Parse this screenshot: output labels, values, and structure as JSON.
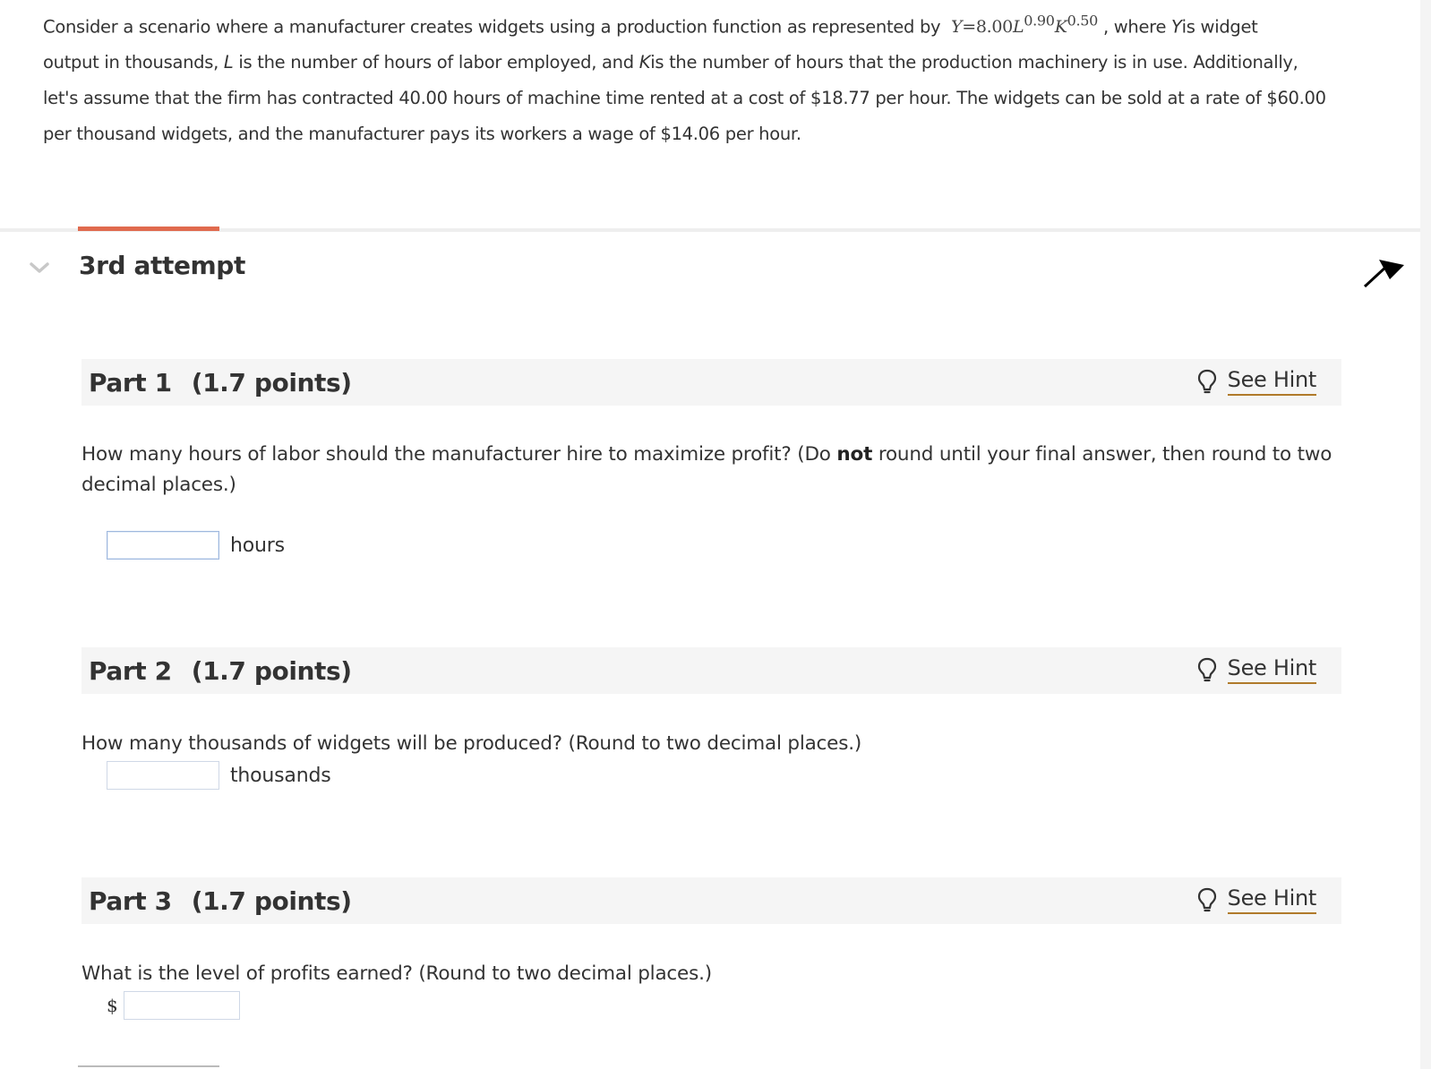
{
  "problem": {
    "line1_a": "Consider a scenario where a manufacturer creates widgets using a production function as represented by",
    "formula": {
      "lhs": "Y",
      "eq": "=8.00",
      "L": "L",
      "L_exp": "0.90",
      "K": "K",
      "K_exp": "0.50"
    },
    "line1_b": ", where",
    "line1_var": "Y",
    "line1_c": "is widget",
    "line2_a": "output in thousands,",
    "line2_var1": "L",
    "line2_b": "is the number of hours of labor employed, and",
    "line2_var2": "K",
    "line2_c": "is the number of hours that the production machinery is in use. Additionally,",
    "line3": "let's assume that the firm has contracted 40.00  hours of machine time rented at a cost of $18.77  per hour. The widgets can be sold at a rate of $60.00",
    "line4": "per thousand widgets, and the manufacturer pays its workers a wage of $14.06  per hour."
  },
  "attempt": {
    "title": "3rd attempt",
    "progress_fraction": 0.1
  },
  "parts": [
    {
      "label": "Part 1",
      "points": "(1.7 points)",
      "hint": "See Hint",
      "question_a": "How many hours of labor should the manufacturer hire to maximize profit? (Do",
      "question_bold": "not",
      "question_b": "round until your final answer, then round to two",
      "question_c": "decimal places.)",
      "unit": "hours",
      "value": ""
    },
    {
      "label": "Part 2",
      "points": "(1.7 points)",
      "hint": "See Hint",
      "question": "How many thousands of widgets will be produced? (Round to two decimal places.)",
      "unit": "thousands",
      "value": ""
    },
    {
      "label": "Part 3",
      "points": "(1.7 points)",
      "hint": "See Hint",
      "question": "What is the level of profits earned? (Round to two decimal places.)",
      "prefix": "$",
      "value": ""
    }
  ],
  "colors": {
    "accent": "#e06a4e",
    "hint_underline": "#b07a2a",
    "part_header_bg": "#f5f5f5"
  }
}
